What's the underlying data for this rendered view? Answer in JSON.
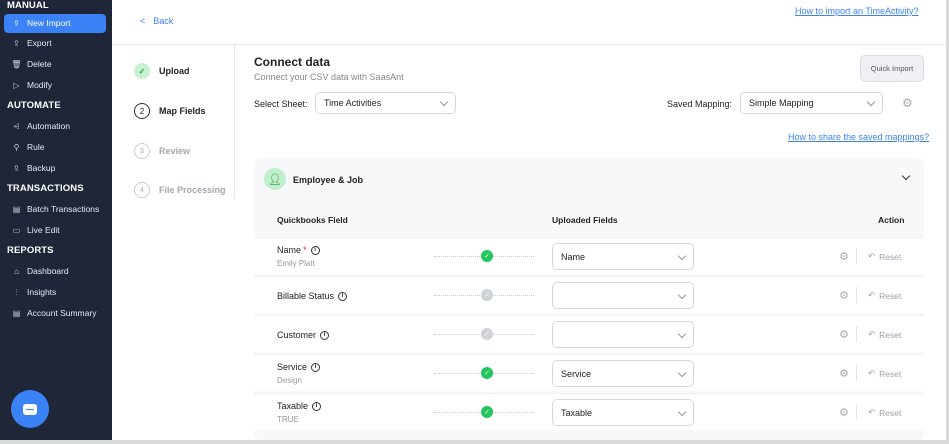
{
  "sidebar": {
    "sections": {
      "manual": "MANUAL",
      "automate": "AUTOMATE",
      "transactions": "TRANSACTIONS",
      "reports": "REPORTS"
    },
    "items": {
      "new_import": "New Import",
      "export": "Export",
      "delete": "Delete",
      "modify": "Modify",
      "automation": "Automation",
      "rule": "Rule",
      "backup": "Backup",
      "batch_transactions": "Batch Transactions",
      "live_edit": "Live Edit",
      "dashboard": "Dashboard",
      "insights": "Insights",
      "account_summary": "Account Summary"
    },
    "accent": "#3b82f6",
    "background": "#1f2638"
  },
  "back_label": "Back",
  "help_import": "How to import an TimeActivity?",
  "steps": [
    {
      "num": "✓",
      "label": "Upload",
      "state": "done"
    },
    {
      "num": "2",
      "label": "Map Fields",
      "state": "current"
    },
    {
      "num": "3",
      "label": "Review",
      "state": "pending"
    },
    {
      "num": "4",
      "label": "File Processing",
      "state": "pending"
    }
  ],
  "connect": {
    "title": "Connect data",
    "subtitle": "Connect your CSV data with SaasAnt",
    "quick_import": "Quick Import",
    "select_sheet_label": "Select Sheet:",
    "select_sheet_value": "Time Activities",
    "saved_mapping_label": "Saved Mapping:",
    "saved_mapping_value": "Simple Mapping",
    "help_share": "How to share the saved mappings?"
  },
  "mapping": {
    "group_title": "Employee & Job",
    "col_qb": "Quickbooks Field",
    "col_uploaded": "Uploaded Fields",
    "col_action": "Action",
    "reset_label": "Reset",
    "rows": [
      {
        "name": "Name",
        "required": "*",
        "sample": "Emily Platt",
        "mapped": "Name",
        "status": "ok"
      },
      {
        "name": "Billable Status",
        "required": "",
        "sample": "",
        "mapped": "",
        "status": "none"
      },
      {
        "name": "Customer",
        "required": "",
        "sample": "",
        "mapped": "",
        "status": "none"
      },
      {
        "name": "Service",
        "required": "",
        "sample": "Design",
        "mapped": "Service",
        "status": "ok"
      },
      {
        "name": "Taxable",
        "required": "",
        "sample": "TRUE",
        "mapped": "Taxable",
        "status": "ok"
      }
    ]
  }
}
